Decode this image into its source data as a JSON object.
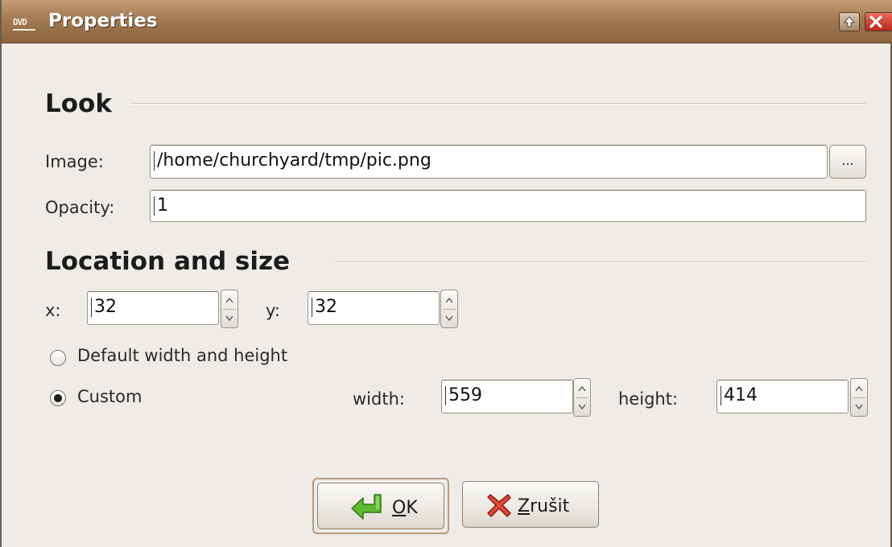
{
  "window": {
    "title": "Properties",
    "app_icon_text": "DVD"
  },
  "look": {
    "heading": "Look",
    "image_label": "Image:",
    "image_value": "/home/churchyard/tmp/pic.png",
    "browse_label": "...",
    "opacity_label": "Opacity:",
    "opacity_value": "1"
  },
  "location": {
    "heading": "Location and size",
    "x_label": "x:",
    "x_value": "32",
    "y_label": "y:",
    "y_value": "32",
    "default_size_label": "Default width and height",
    "custom_label": "Custom",
    "size_mode_selected": "Custom",
    "width_label": "width:",
    "width_value": "559",
    "height_label": "height:",
    "height_value": "414"
  },
  "buttons": {
    "ok_mnemonic": "O",
    "ok_rest": "K",
    "cancel_mnemonic": "Z",
    "cancel_rest": "rušit"
  },
  "icons": {
    "titlebar_maximize": "arrow-up-icon",
    "titlebar_close": "close-icon",
    "ok": "green-enter-arrow-icon",
    "cancel": "red-x-icon"
  },
  "colors": {
    "titlebar": "#a37a52",
    "window_bg": "#efebe7",
    "close_button": "#d0382a",
    "ok_icon": "#4ea32a",
    "cancel_icon": "#d63a2c"
  }
}
